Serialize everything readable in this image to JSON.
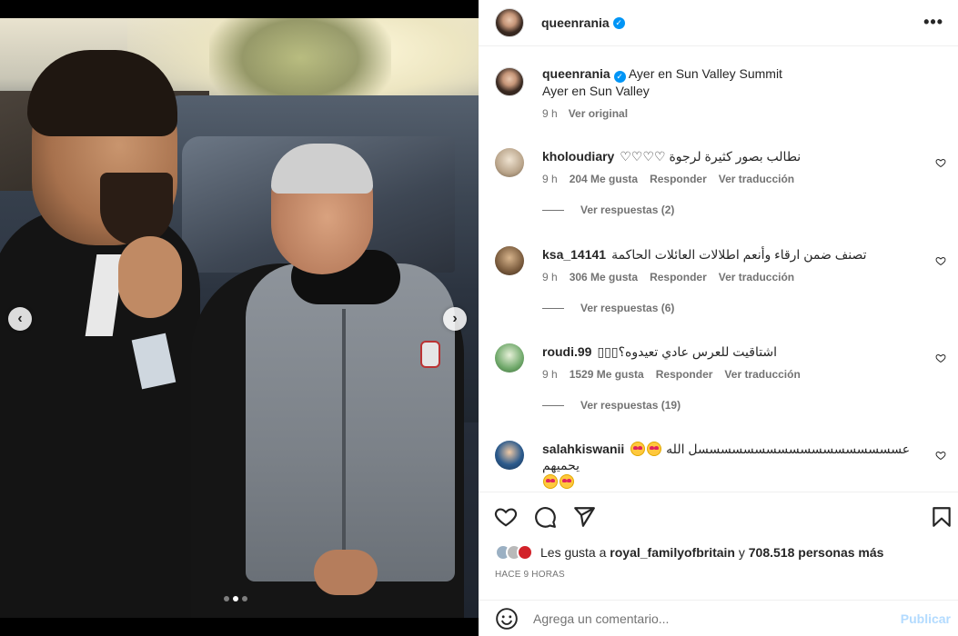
{
  "post": {
    "username": "queenrania",
    "more_icon": "more-icon",
    "caption_location": "Ayer en Sun Valley Summit",
    "caption_text": "Ayer en Sun Valley",
    "caption_time": "9 h",
    "caption_translate": "Ver original"
  },
  "comments": [
    {
      "username": "kholoudiary",
      "text": "نطالب بصور كثيرة لرجوة ♡♡♡♡",
      "time": "9 h",
      "likes": "204 Me gusta",
      "reply": "Responder",
      "translate": "Ver traducción",
      "replies": "Ver respuestas (2)",
      "avatar_color": "#b9a48a"
    },
    {
      "username": "ksa_14141",
      "text": "تصنف ضمن ارقاء وأنعم اطلالات العائلات الحاكمة",
      "time": "9 h",
      "likes": "306 Me gusta",
      "reply": "Responder",
      "translate": "Ver traducción",
      "replies": "Ver respuestas (6)",
      "avatar_color": "#7a5b3d"
    },
    {
      "username": "roudi.99",
      "text": "اشتاقيت للعرس عادي تعيدوه؟▯▯▯",
      "time": "9 h",
      "likes": "1529 Me gusta",
      "reply": "Responder",
      "translate": "Ver traducción",
      "replies": "Ver respuestas (19)",
      "avatar_color": "#6fa86a"
    },
    {
      "username": "salahkiswanii",
      "text": "عسسسسسسسسسسسسسسسسسسل الله يحميهم",
      "avatar_color": "#2b5a8c"
    }
  ],
  "likes": {
    "prefix": "Les gusta a",
    "user": "royal_familyofbritain",
    "joiner": "y",
    "count": "708.518 personas más"
  },
  "ago": "HACE 9 HORAS",
  "add_comment": {
    "placeholder": "Agrega un comentario...",
    "publish": "Publicar"
  },
  "carousel": {
    "total": 3,
    "active": 2
  },
  "colors": {
    "accent": "#0095f6",
    "text": "#262626",
    "muted": "#737373",
    "publish_disabled": "#b3dbff"
  }
}
